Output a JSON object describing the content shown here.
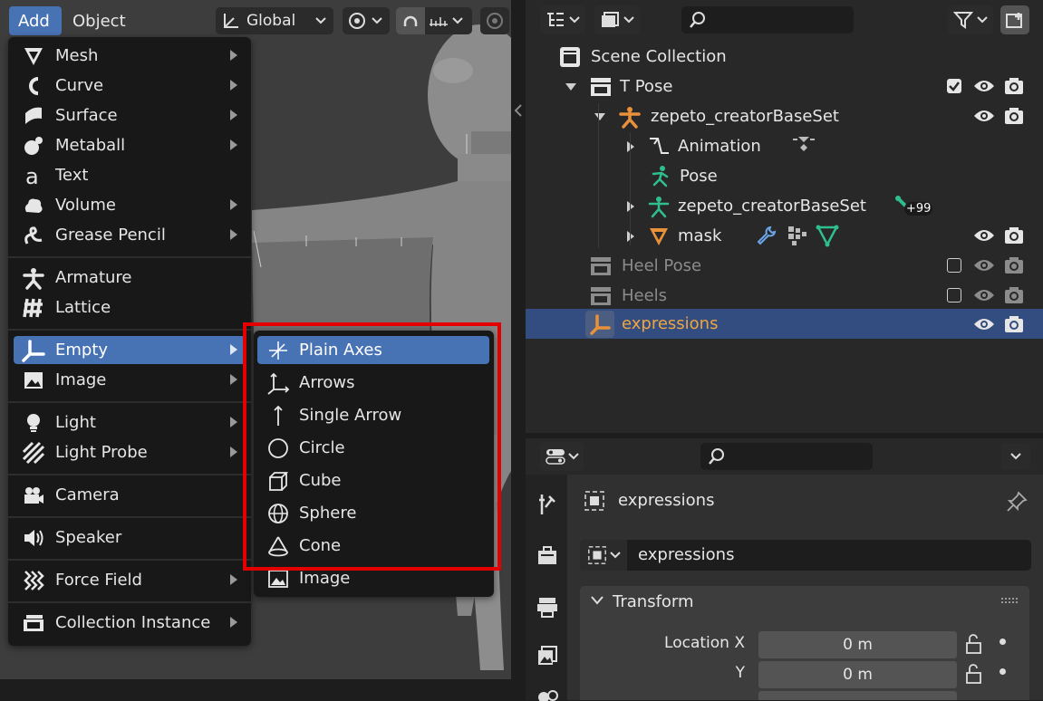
{
  "viewport": {
    "menus": {
      "add": "Add",
      "object": "Object"
    },
    "transform_orientation": "Global"
  },
  "add_menu": {
    "items": [
      {
        "label": "Mesh",
        "icon": "mesh-icon"
      },
      {
        "label": "Curve",
        "icon": "curve-icon"
      },
      {
        "label": "Surface",
        "icon": "surface-icon"
      },
      {
        "label": "Metaball",
        "icon": "metaball-icon"
      },
      {
        "label": "Text",
        "icon": "text-icon"
      },
      {
        "label": "Volume",
        "icon": "volume-icon"
      },
      {
        "label": "Grease Pencil",
        "icon": "grease-pencil-icon"
      },
      {
        "label": "Armature",
        "icon": "armature-icon"
      },
      {
        "label": "Lattice",
        "icon": "lattice-icon"
      },
      {
        "label": "Empty",
        "icon": "empty-icon"
      },
      {
        "label": "Image",
        "icon": "image-icon"
      },
      {
        "label": "Light",
        "icon": "light-icon"
      },
      {
        "label": "Light Probe",
        "icon": "light-probe-icon"
      },
      {
        "label": "Camera",
        "icon": "camera-icon"
      },
      {
        "label": "Speaker",
        "icon": "speaker-icon"
      },
      {
        "label": "Force Field",
        "icon": "force-field-icon"
      },
      {
        "label": "Collection Instance",
        "icon": "collection-instance-icon"
      }
    ]
  },
  "empty_submenu": {
    "items": [
      {
        "label": "Plain Axes",
        "icon": "plain-axes-icon"
      },
      {
        "label": "Arrows",
        "icon": "arrows-icon"
      },
      {
        "label": "Single Arrow",
        "icon": "single-arrow-icon"
      },
      {
        "label": "Circle",
        "icon": "circle-icon"
      },
      {
        "label": "Cube",
        "icon": "cube-icon"
      },
      {
        "label": "Sphere",
        "icon": "sphere-icon"
      },
      {
        "label": "Cone",
        "icon": "cone-icon"
      },
      {
        "label": "Image",
        "icon": "image-icon"
      }
    ]
  },
  "outliner": {
    "rows": [
      {
        "label": "Scene Collection"
      },
      {
        "label": "T Pose"
      },
      {
        "label": "zepeto_creatorBaseSet"
      },
      {
        "label": "Animation"
      },
      {
        "label": "Pose"
      },
      {
        "label": "zepeto_creatorBaseSet"
      },
      {
        "label": "mask"
      },
      {
        "label": "Heel Pose"
      },
      {
        "label": "Heels"
      },
      {
        "label": "expressions"
      }
    ],
    "badge": "+99"
  },
  "properties": {
    "object_name": "expressions",
    "data_block": "expressions",
    "transform_label": "Transform",
    "location_x_label": "Location X",
    "location_y_label": "Y",
    "location_x_value": "0 m",
    "location_y_value": "0 m"
  },
  "colors": {
    "accent": "#4772b3",
    "selected_row": "#334d80",
    "highlight_box": "#e40000",
    "armature_orange": "#e8913a",
    "pose_green": "#2fbf8f"
  }
}
